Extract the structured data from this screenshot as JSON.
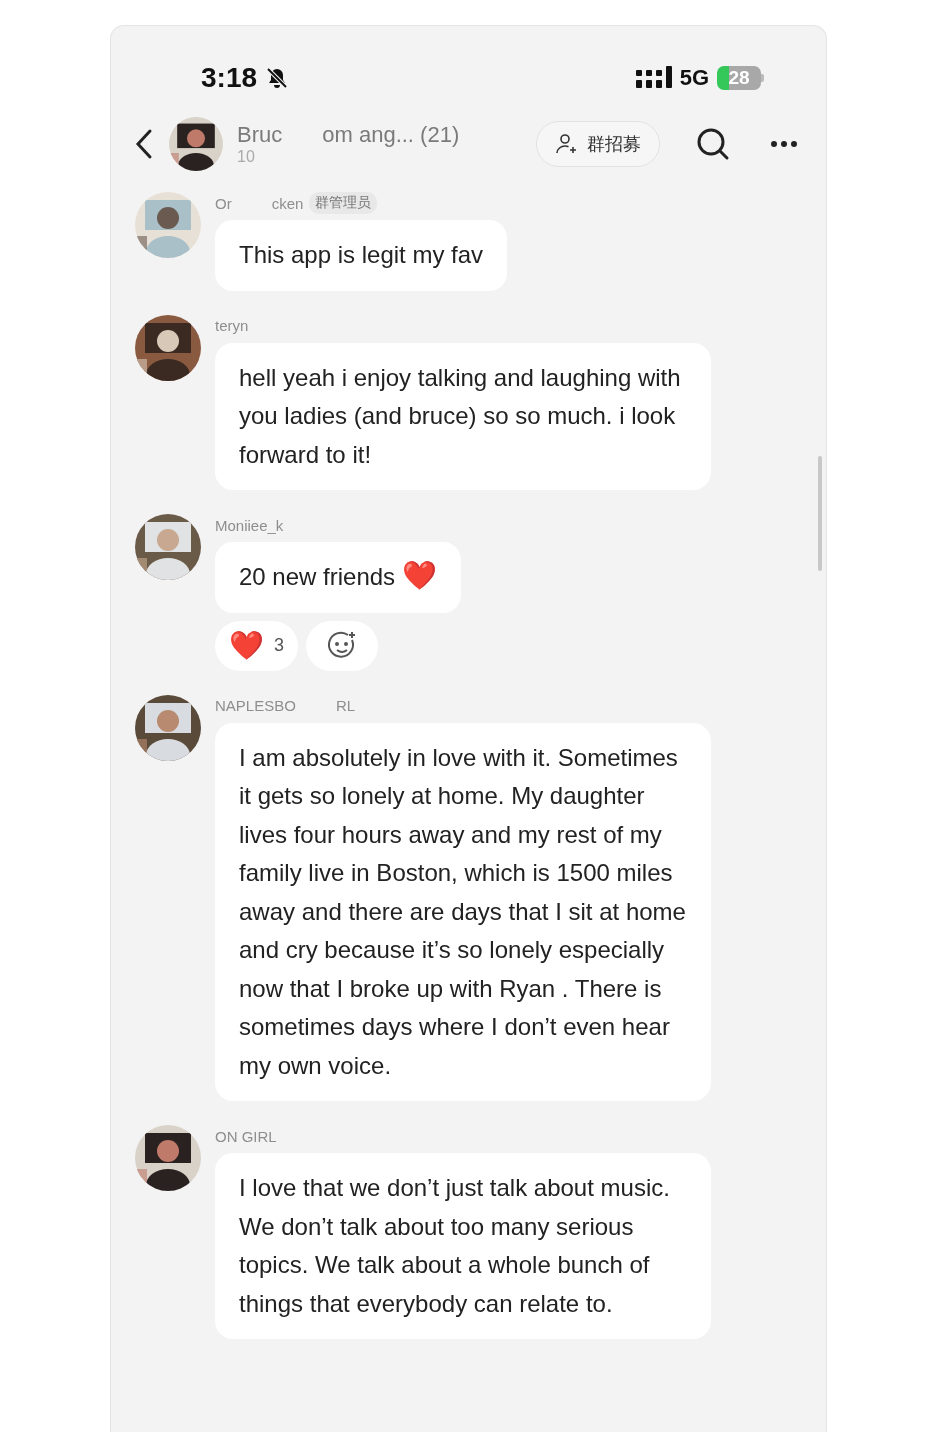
{
  "status_bar": {
    "time": "3:18",
    "network": "5G",
    "battery": "28"
  },
  "header": {
    "title_parts": [
      "Bruc",
      "om ang... (21)"
    ],
    "subtitle": "10",
    "recruit_button": "群招募"
  },
  "messages": [
    {
      "sender_parts": [
        "Or",
        "cken"
      ],
      "badge": "群管理员",
      "text": "This app is legit my fav"
    },
    {
      "sender_parts": [
        "teryn"
      ],
      "text": "hell yeah i enjoy talking and laughing with you ladies (and bruce) so so much. i look forward to it!"
    },
    {
      "sender_parts": [
        "Moniiee_k"
      ],
      "text": "20 new friends",
      "emoji": "❤️",
      "reactions": [
        {
          "emoji": "❤️",
          "count": "3"
        }
      ]
    },
    {
      "sender_parts": [
        "NAPLESBO",
        "RL"
      ],
      "text": "I am absolutely in love with it. Sometimes it gets so lonely at home. My daughter lives four hours away and my rest of my family live in Boston, which is 1500 miles away and there are days that I sit at home and cry because it’s so lonely especially now that I broke up with Ryan .  There is sometimes days where I don’t even hear my own voice."
    },
    {
      "sender_parts": [
        "ON GIRL"
      ],
      "text": "I love that we don’t just talk about music. We don’t talk about too many serious topics. We talk about a whole bunch of things that everybody can relate to."
    }
  ]
}
